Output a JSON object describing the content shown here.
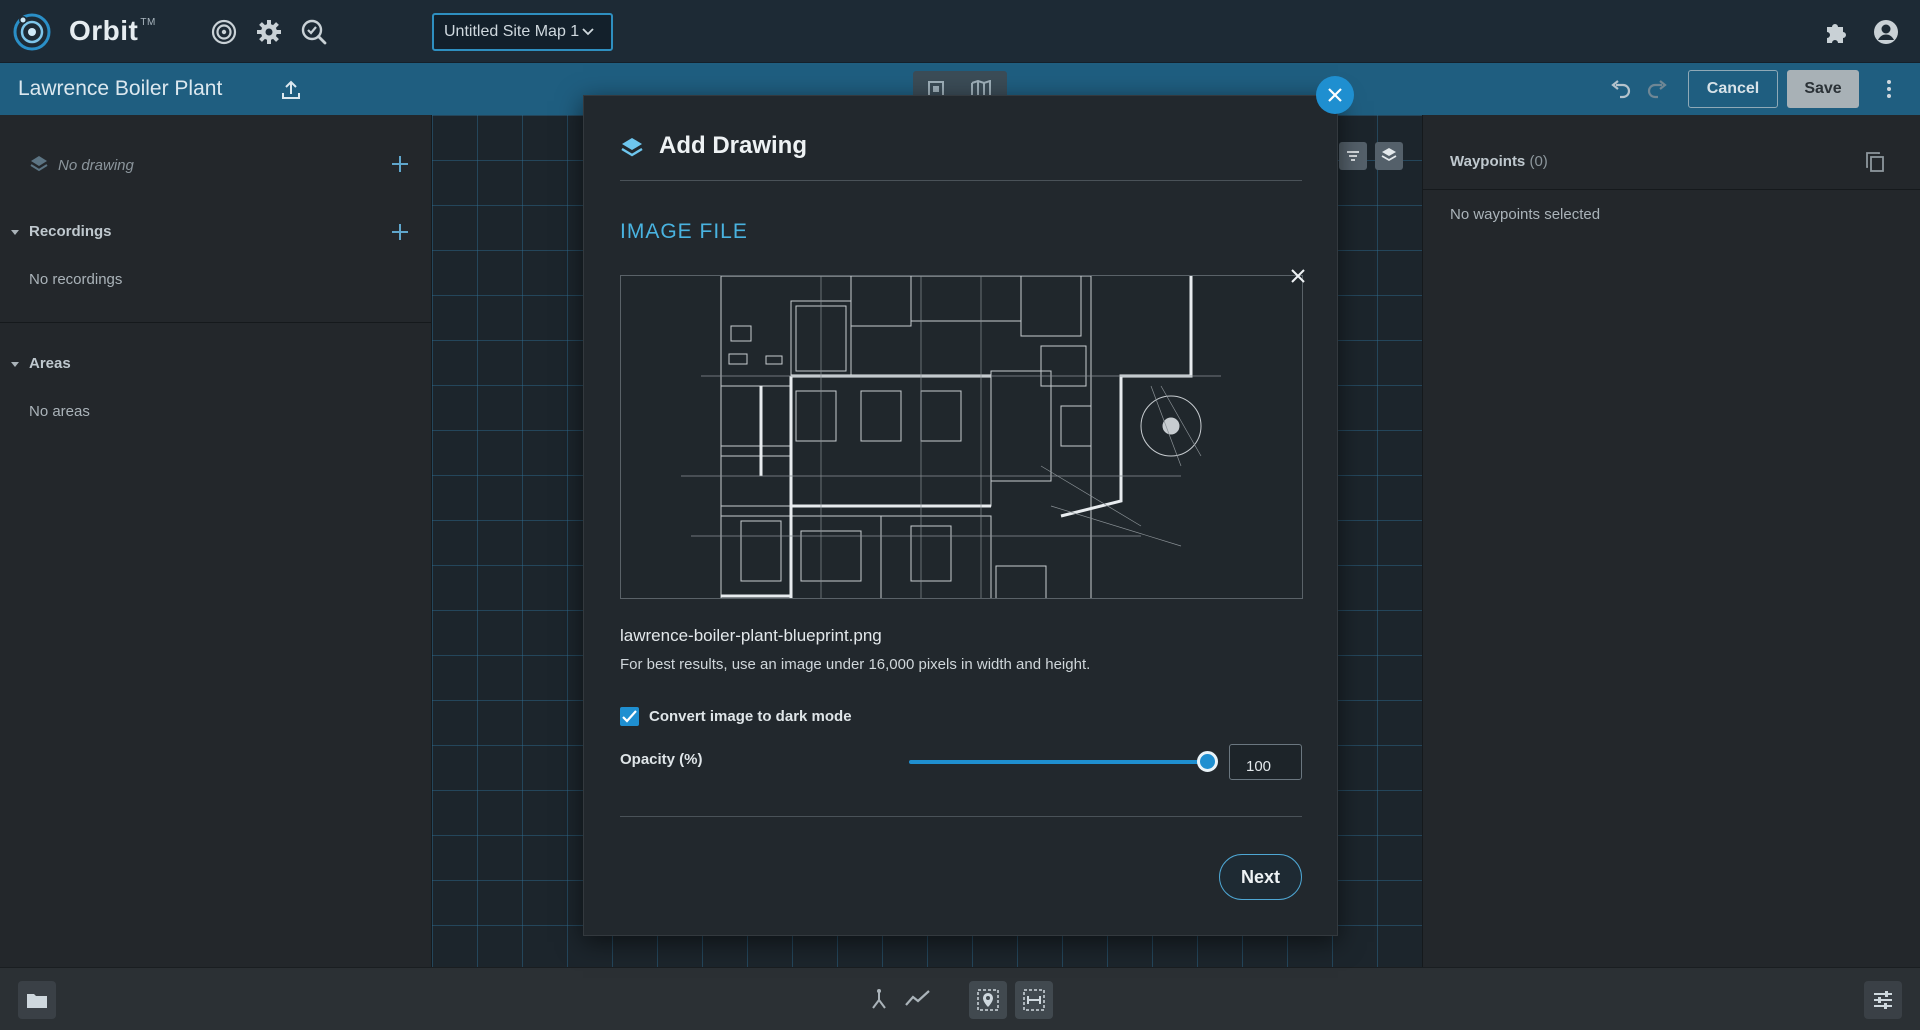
{
  "topbar": {
    "brand": "Orbit",
    "trademark": "TM",
    "site_map_select": "Untitled Site Map 1"
  },
  "subbar": {
    "site_name": "Lawrence Boiler Plant",
    "cancel_label": "Cancel",
    "save_label": "Save"
  },
  "left_panel": {
    "drawing_placeholder": "No drawing",
    "recordings_title": "Recordings",
    "recordings_empty": "No recordings",
    "areas_title": "Areas",
    "areas_empty": "No areas"
  },
  "right_panel": {
    "waypoints_title": "Waypoints",
    "waypoints_count": "(0)",
    "waypoints_empty": "No waypoints selected"
  },
  "modal": {
    "title": "Add Drawing",
    "section_label": "IMAGE FILE",
    "filename": "lawrence-boiler-plant-blueprint.png",
    "hint": "For best results, use an image under 16,000 pixels in width and height.",
    "dark_mode_label": "Convert image to dark mode",
    "dark_mode_checked": true,
    "opacity_label": "Opacity (%)",
    "opacity_value": "100",
    "next_label": "Next"
  },
  "colors": {
    "accent": "#1f8fd0",
    "section_label": "#49b3e0",
    "subbar": "#1f5e80",
    "topbar": "#1d2a35"
  }
}
